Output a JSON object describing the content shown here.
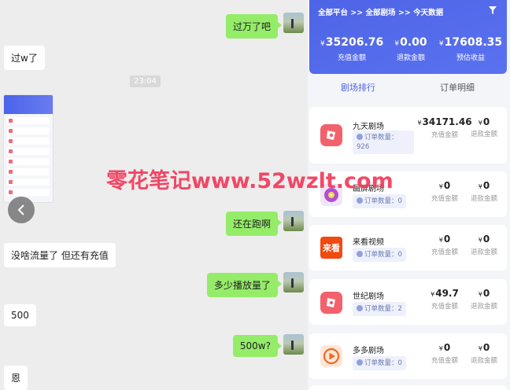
{
  "chat": {
    "messages": [
      {
        "side": "right",
        "text": "过万了吧"
      },
      {
        "side": "left",
        "text": "过w了"
      },
      {
        "side": "right",
        "text": "还在跑啊"
      },
      {
        "side": "left",
        "text": "没啥流量了 但还有充值"
      },
      {
        "side": "right",
        "text": "多少播放量了"
      },
      {
        "side": "left",
        "text": "500"
      },
      {
        "side": "right",
        "text": "500w?"
      },
      {
        "side": "left",
        "text": "恩"
      }
    ],
    "timestamp": "23:04",
    "back_icon": "chevron-left-icon"
  },
  "panel": {
    "breadcrumb": "全部平台 >> 全部剧场 >> 今天数据",
    "filter_icon": "filter-icon",
    "stats": [
      {
        "currency": "¥",
        "value": "35206.76",
        "label": "充值金额"
      },
      {
        "currency": "¥",
        "value": "0.00",
        "label": "退款金额"
      },
      {
        "currency": "¥",
        "value": "17608.35",
        "label": "预估收益"
      }
    ],
    "tabs": [
      {
        "label": "剧场排行",
        "active": true
      },
      {
        "label": "订单明细",
        "active": false
      }
    ],
    "cards": [
      {
        "name": "九天剧场",
        "orders": "订单数量：926",
        "recharge": "34171.46",
        "recharge_label": "充值金额",
        "refund": "0",
        "refund_label": "退款金额",
        "icon": "theater-icon",
        "icon_color": "#f2616c"
      },
      {
        "name": "画屏剧场",
        "orders": "订单数量：0",
        "recharge": "0",
        "recharge_label": "充值金额",
        "refund": "0",
        "refund_label": "退款金额",
        "icon": "disc-icon",
        "icon_color": "#b04fd6"
      },
      {
        "name": "来看视频",
        "orders": "订单数量：0",
        "recharge": "0",
        "recharge_label": "充值金额",
        "refund": "0",
        "refund_label": "退款金额",
        "icon": "laikan-icon",
        "icon_color": "#f04a12",
        "icon_text": "来看"
      },
      {
        "name": "世纪剧场",
        "orders": "订单数量：2",
        "recharge": "49.7",
        "recharge_label": "充值金额",
        "refund": "0",
        "refund_label": "退款金额",
        "icon": "theater-icon",
        "icon_color": "#f2616c"
      },
      {
        "name": "多多剧场",
        "orders": "订单数量：0",
        "recharge": "0",
        "recharge_label": "充值金额",
        "refund": "0",
        "refund_label": "退款金额",
        "icon": "play-icon",
        "icon_color": "#f06a1e"
      }
    ],
    "currency": "¥"
  },
  "watermark": "零花笔记www.52wzlt.com"
}
